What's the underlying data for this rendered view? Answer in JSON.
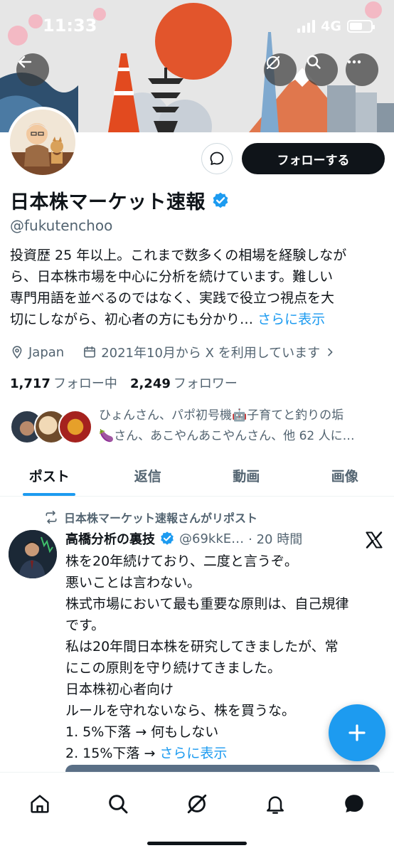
{
  "status_bar": {
    "time": "11:33",
    "network": "4G"
  },
  "profile": {
    "display_name": "日本株マーケット速報",
    "handle": "@fukutenchoo",
    "bio_lines": [
      "投資歴 25 年以上。これまで数多くの相場を経験しなが",
      "ら、日本株市場を中心に分析を続けています。難しい",
      "専門用語を並べるのではなく、実践で役立つ視点を大",
      "切にしながら、初心者の方にも分かり…"
    ],
    "bio_more": "さらに表示",
    "location": "Japan",
    "joined": "2021年10月から X を利用しています",
    "following_count": "1,717",
    "following_label": "フォロー中",
    "followers_count": "2,249",
    "followers_label": "フォロワー",
    "known_followers_line1": "ひょんさん、パポ初号機🤖子育てと釣りの垢",
    "known_followers_line2": "🍆さん、あこやんあこやんさん、他 62 人に…"
  },
  "buttons": {
    "follow": "フォローする"
  },
  "tabs": [
    {
      "label": "ポスト",
      "active": true
    },
    {
      "label": "返信",
      "active": false
    },
    {
      "label": "動画",
      "active": false
    },
    {
      "label": "画像",
      "active": false
    }
  ],
  "post": {
    "repost_label": "日本株マーケット速報さんがリポスト",
    "author": "高橋分析の裏技",
    "author_handle": "@69kkE…",
    "time": "· 20 時間",
    "body_lines": [
      "株を20年続けており、二度と言うぞ。",
      "悪いことは言わない。",
      "株式市場において最も重要な原則は、自己規律",
      "です。",
      "私は20年間日本株を研究してきましたが、常",
      "にこの原則を守り続けてきました。",
      "日本株初心者向け",
      "ルールを守れないなら、株を買うな。",
      "1. 5%下落 → 何もしない"
    ],
    "last_line": "2. 15%下落 → ",
    "more": "さらに表示"
  },
  "icons": {
    "back": "back-arrow-icon",
    "grok": "grok-icon",
    "search": "search-icon",
    "more": "more-icon",
    "verified": "verified-badge-icon",
    "location": "location-pin-icon",
    "calendar": "calendar-icon",
    "repost": "repost-icon",
    "x": "x-logo-icon",
    "compose": "plus-icon"
  },
  "colors": {
    "accent": "#1d9bf0",
    "text": "#0f1419",
    "muted": "#536471"
  }
}
